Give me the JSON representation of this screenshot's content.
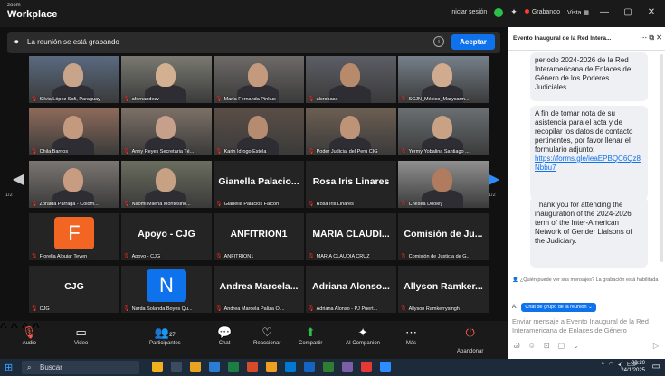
{
  "window": {
    "app_small": "zoom",
    "app_name": "Workplace",
    "signin": "Iniciar sesión",
    "recording": "Grabando",
    "view": "Vista",
    "minimize": "—",
    "maximize": "▢",
    "close": "✕"
  },
  "recbar": {
    "text": "La reunión se está grabando",
    "accept": "Aceptar"
  },
  "gallery": {
    "page_left": "1/2",
    "page_right": "1/2",
    "tiles": [
      {
        "name": "Silvia López Safi, Paraguay",
        "big": "",
        "avatar": ""
      },
      {
        "name": "afernandezv",
        "big": "",
        "avatar": ""
      },
      {
        "name": "María Fernanda Pinkus",
        "big": "",
        "avatar": ""
      },
      {
        "name": "alcrobasa",
        "big": "",
        "avatar": ""
      },
      {
        "name": "SCJN_México_Marycarm...",
        "big": "",
        "avatar": ""
      },
      {
        "name": "Chila Barrios",
        "big": "",
        "avatar": ""
      },
      {
        "name": "Anny Reyes Secretaria Té...",
        "big": "",
        "avatar": ""
      },
      {
        "name": "Karin Idrogo Estela",
        "big": "",
        "avatar": ""
      },
      {
        "name": "Poder Judicial del Perú CIG",
        "big": "",
        "avatar": ""
      },
      {
        "name": "Yermy Yobalina Santiago ...",
        "big": "",
        "avatar": ""
      },
      {
        "name": "Zoraida Párraga - Colom...",
        "big": "",
        "avatar": ""
      },
      {
        "name": "Naomi Milena Montesino...",
        "big": "",
        "avatar": ""
      },
      {
        "name": "Gianella Palacios Falcón",
        "big": "Gianella Palacio...",
        "avatar": ""
      },
      {
        "name": "Rosa Iris Linares",
        "big": "Rosa Iris Linares",
        "avatar": ""
      },
      {
        "name": "Chesea Dooley",
        "big": "",
        "avatar": ""
      },
      {
        "name": "Fiorella Albujar Teven",
        "big": "",
        "avatar": "F"
      },
      {
        "name": "Apoyo - CJG",
        "big": "Apoyo - CJG",
        "avatar": ""
      },
      {
        "name": "ANFITRION1",
        "big": "ANFITRION1",
        "avatar": ""
      },
      {
        "name": "MARIA CLAUDIA CRUZ",
        "big": "MARIA CLAUDI...",
        "avatar": ""
      },
      {
        "name": "Comisión de Justicia de G...",
        "big": "Comisión de Ju...",
        "avatar": ""
      },
      {
        "name": "CJG",
        "big": "CJG",
        "avatar": ""
      },
      {
        "name": "Narda Solanda Boyes Qu...",
        "big": "",
        "avatar": "N"
      },
      {
        "name": "Andrea Marcela Paliza Ol...",
        "big": "Andrea Marcela...",
        "avatar": ""
      },
      {
        "name": "Adriana Alonso - PJ Puert...",
        "big": "Adriana Alonso...",
        "avatar": ""
      },
      {
        "name": "Allyson Ramkerrysingh",
        "big": "Allyson Ramker...",
        "avatar": ""
      }
    ]
  },
  "toolbar": {
    "audio": "Audio",
    "video": "Video",
    "participants": "Participantes",
    "participants_count": "27",
    "chat": "Chat",
    "react": "Reaccionar",
    "share": "Compartir",
    "companion": "AI Companion",
    "more": "Más",
    "leave": "Abandonar"
  },
  "chat": {
    "title": "Evento Inaugural de la Red Intera...",
    "msg1": "periodo 2024-2026 de la Red Interamericana de Enlaces de Género de los Poderes Judiciales.",
    "msg2": "A fin de tomar nota de su asistencia para el acta y de recopilar los datos de contacto pertinentes, por favor llenar el formulario adjunto:",
    "msg2_link": "https://forms.gle/ieaEPBQC6Qz8Nbbu7",
    "msg3": "Thank you for attending the inauguration of the 2024-2026 term of the Inter-American Network of Gender Liaisons of the Judiciary.",
    "notice": "¿Quién puede ver sus mensajes? La grabación está habilitada",
    "to_label": "A:",
    "to_target": "Chat de grupo de la reunión",
    "input_placeholder": "Enviar mensaje a Evento Inaugural de la Red Interamericana de Enlaces de Género"
  },
  "taskbar": {
    "search": "Buscar",
    "lang": "ESP",
    "time": "09:20",
    "date": "24/1/2025"
  },
  "colors": {
    "accent": "#0e72ed",
    "recording": "#ff3b30",
    "active_speaker": "#2bbf49",
    "avatar_f": "#f26522",
    "avatar_n": "#0e72ed"
  }
}
